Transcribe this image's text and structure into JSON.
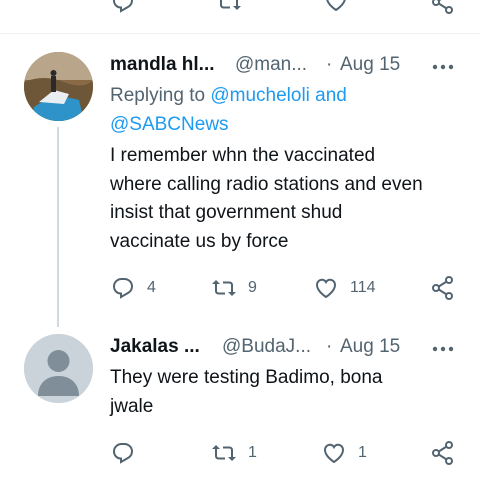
{
  "previous_tweet_actions": {
    "reply_icon": "reply-icon",
    "retweet_icon": "retweet-icon",
    "like_icon": "heart-icon",
    "share_icon": "share-icon"
  },
  "tweets": [
    {
      "display_name": "mandla hl...",
      "handle": "@man...",
      "separator": "·",
      "date": "Aug 15",
      "more_icon": "more-dots-icon",
      "replying_to_label": "Replying to",
      "replying_to_user1": "@mucheloli",
      "replying_to_and": "and",
      "replying_to_user2": "@SABCNews",
      "text_lines": [
        "I remember whn the vaccinated",
        "where calling radio stations and even",
        "insist that government shud",
        "vaccinate us by force"
      ],
      "replies": "4",
      "retweets": "9",
      "likes": "114"
    },
    {
      "display_name": "Jakalas ...",
      "handle": "@BudaJ...",
      "separator": "·",
      "date": "Aug 15",
      "more_icon": "more-dots-icon",
      "text_lines": [
        "They were testing Badimo, bona",
        "jwale"
      ],
      "replies": "",
      "retweets": "1",
      "likes": "1"
    }
  ],
  "colors": {
    "link": "#1d9bf0",
    "secondary_text": "#536471",
    "thread_line": "#cfd9de"
  }
}
